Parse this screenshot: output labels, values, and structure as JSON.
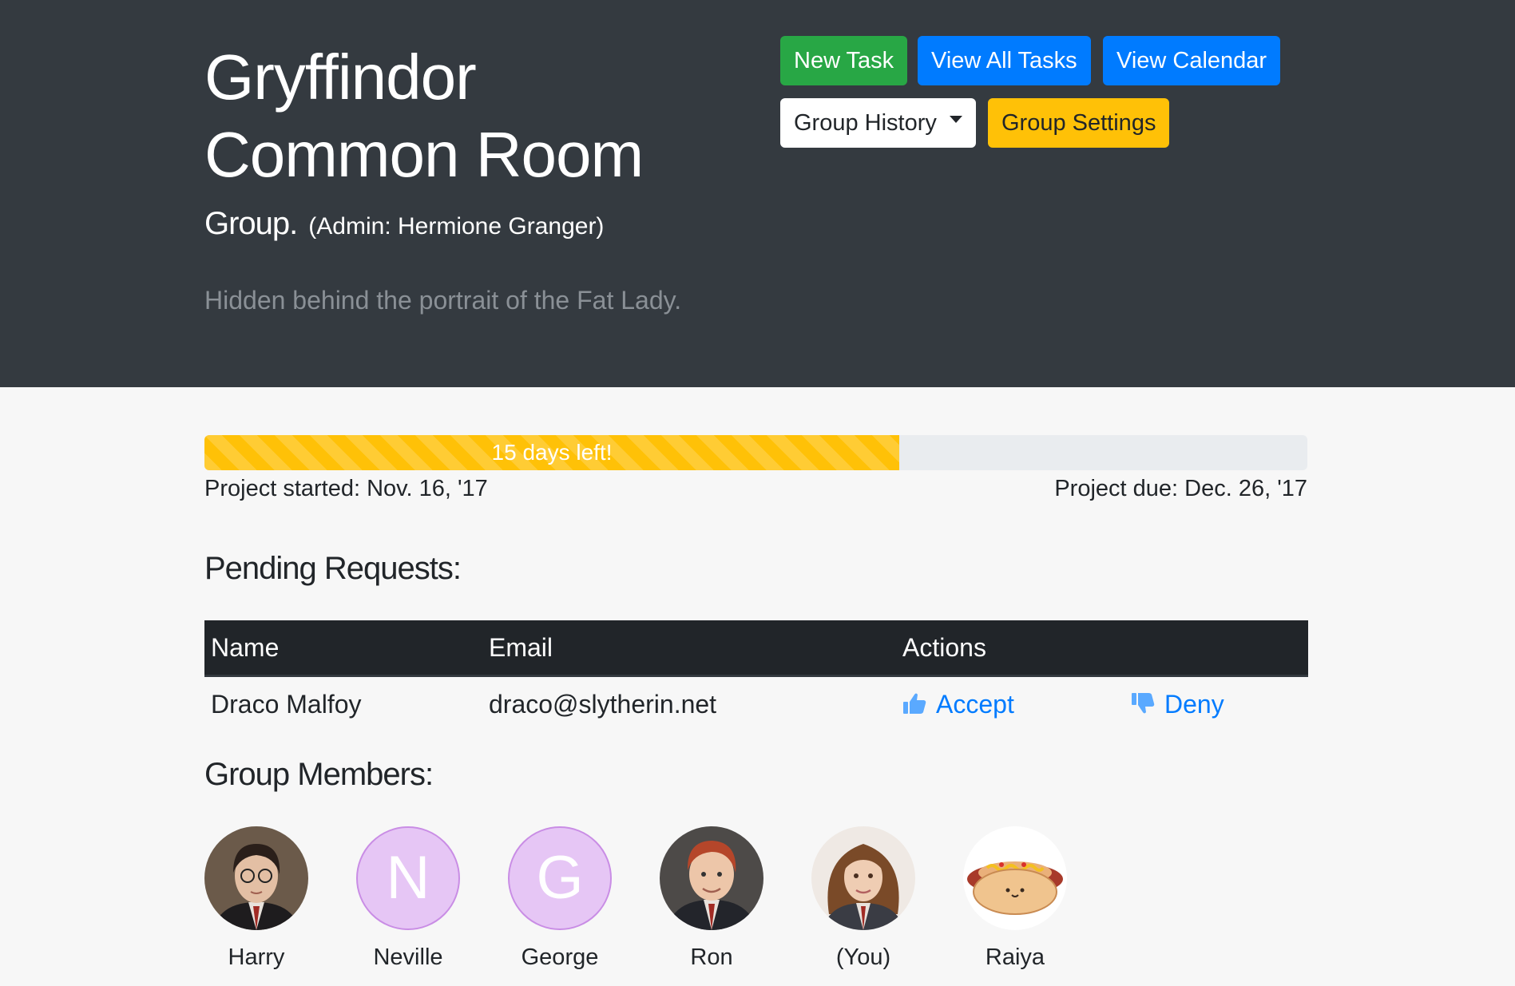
{
  "header": {
    "title_line1": "Gryffindor",
    "title_line2": "Common Room",
    "subtitle": "Group.",
    "admin": "(Admin: Hermione Granger)",
    "description": "Hidden behind the portrait of the Fat Lady."
  },
  "toolbar": {
    "new_task": "New Task",
    "view_all_tasks": "View All Tasks",
    "view_calendar": "View Calendar",
    "group_history": "Group History",
    "group_settings": "Group Settings"
  },
  "progress": {
    "label": "15 days left!",
    "fraction": 0.63,
    "started": "Project started: Nov. 16, '17",
    "due": "Project due: Dec. 26, '17"
  },
  "pending": {
    "heading": "Pending Requests:",
    "columns": [
      "Name",
      "Email",
      "Actions"
    ],
    "rows": [
      {
        "name": "Draco Malfoy",
        "email": "draco@slytherin.net",
        "accept": "Accept",
        "deny": "Deny"
      }
    ]
  },
  "members": {
    "heading": "Group Members:",
    "list": [
      {
        "name": "Harry",
        "avatar": "photo-avatar"
      },
      {
        "name": "Neville",
        "avatar": "letter-avatar",
        "initial": "N"
      },
      {
        "name": "George",
        "avatar": "letter-avatar",
        "initial": "G"
      },
      {
        "name": "Ron",
        "avatar": "photo-avatar"
      },
      {
        "name": "(You)",
        "avatar": "photo-avatar"
      },
      {
        "name": "Raiya",
        "avatar": "hotdog-icon"
      }
    ]
  },
  "colors": {
    "hero_bg": "#343a40",
    "primary": "#007bff",
    "success": "#28a745",
    "warning": "#ffc107",
    "letter_avatar_bg": "#e6c6f5"
  }
}
